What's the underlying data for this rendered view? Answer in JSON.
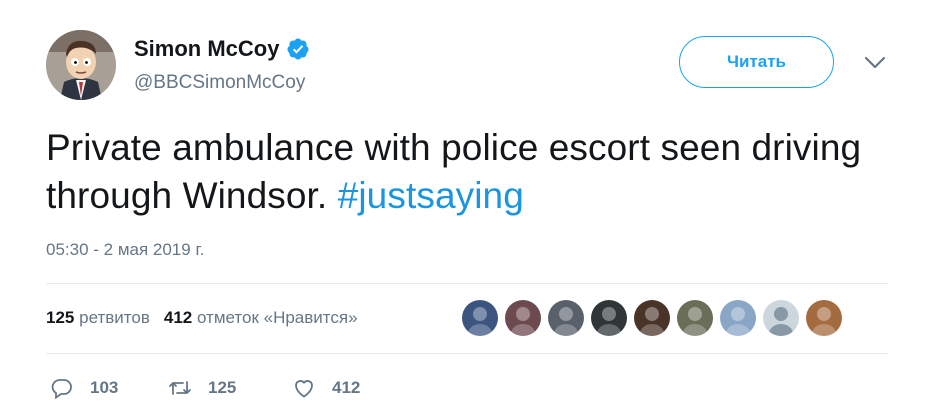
{
  "author": {
    "display_name": "Simon McCoy",
    "handle": "@BBCSimonMcCoy",
    "verified": true,
    "avatar_icon": "cartoon-avatar"
  },
  "follow_button": {
    "label": "Читать"
  },
  "tweet": {
    "text": "Private ambulance with police escort seen driving through Windsor. ",
    "hashtag": "#justsaying",
    "timestamp": "05:30 - 2 мая 2019 г."
  },
  "stats": {
    "retweets_count": "125",
    "retweets_label": "ретвитов",
    "likes_count": "412",
    "likes_label": "отметок «Нравится»"
  },
  "liked_by": [
    {
      "name": "liker-avatar",
      "color": "#3b5580"
    },
    {
      "name": "liker-avatar",
      "color": "#6d4a4f"
    },
    {
      "name": "liker-avatar",
      "color": "#58606a"
    },
    {
      "name": "liker-avatar",
      "color": "#2f3638"
    },
    {
      "name": "liker-avatar",
      "color": "#4a3428"
    },
    {
      "name": "liker-avatar",
      "color": "#6a6e58"
    },
    {
      "name": "liker-avatar",
      "color": "#8aa6c7"
    },
    {
      "name": "liker-avatar",
      "color": "#ccd6dd"
    },
    {
      "name": "liker-avatar",
      "color": "#a46b3f"
    }
  ],
  "actions": {
    "reply_count": "103",
    "retweet_count": "125",
    "like_count": "412"
  },
  "colors": {
    "accent": "#1da1f2",
    "hashtag": "#1b95e0",
    "secondary_text": "#657786"
  }
}
